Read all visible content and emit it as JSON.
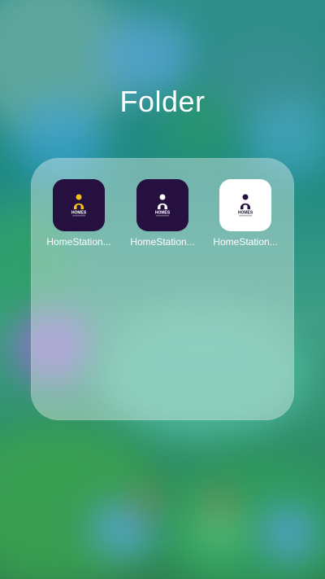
{
  "folder": {
    "title": "Folder",
    "apps": [
      {
        "label": "HomeStation...",
        "icon_text": "HOMES",
        "icon_style": "dark",
        "accent_color": "#f4c21a"
      },
      {
        "label": "HomeStation...",
        "icon_text": "HOMES",
        "icon_style": "dark",
        "accent_color": "#ffffff"
      },
      {
        "label": "HomeStation...",
        "icon_text": "HOMES",
        "icon_style": "light",
        "accent_color": "#25103f"
      }
    ]
  },
  "colors": {
    "icon_dark_bg": "#25103f",
    "icon_light_bg": "#ffffff"
  }
}
